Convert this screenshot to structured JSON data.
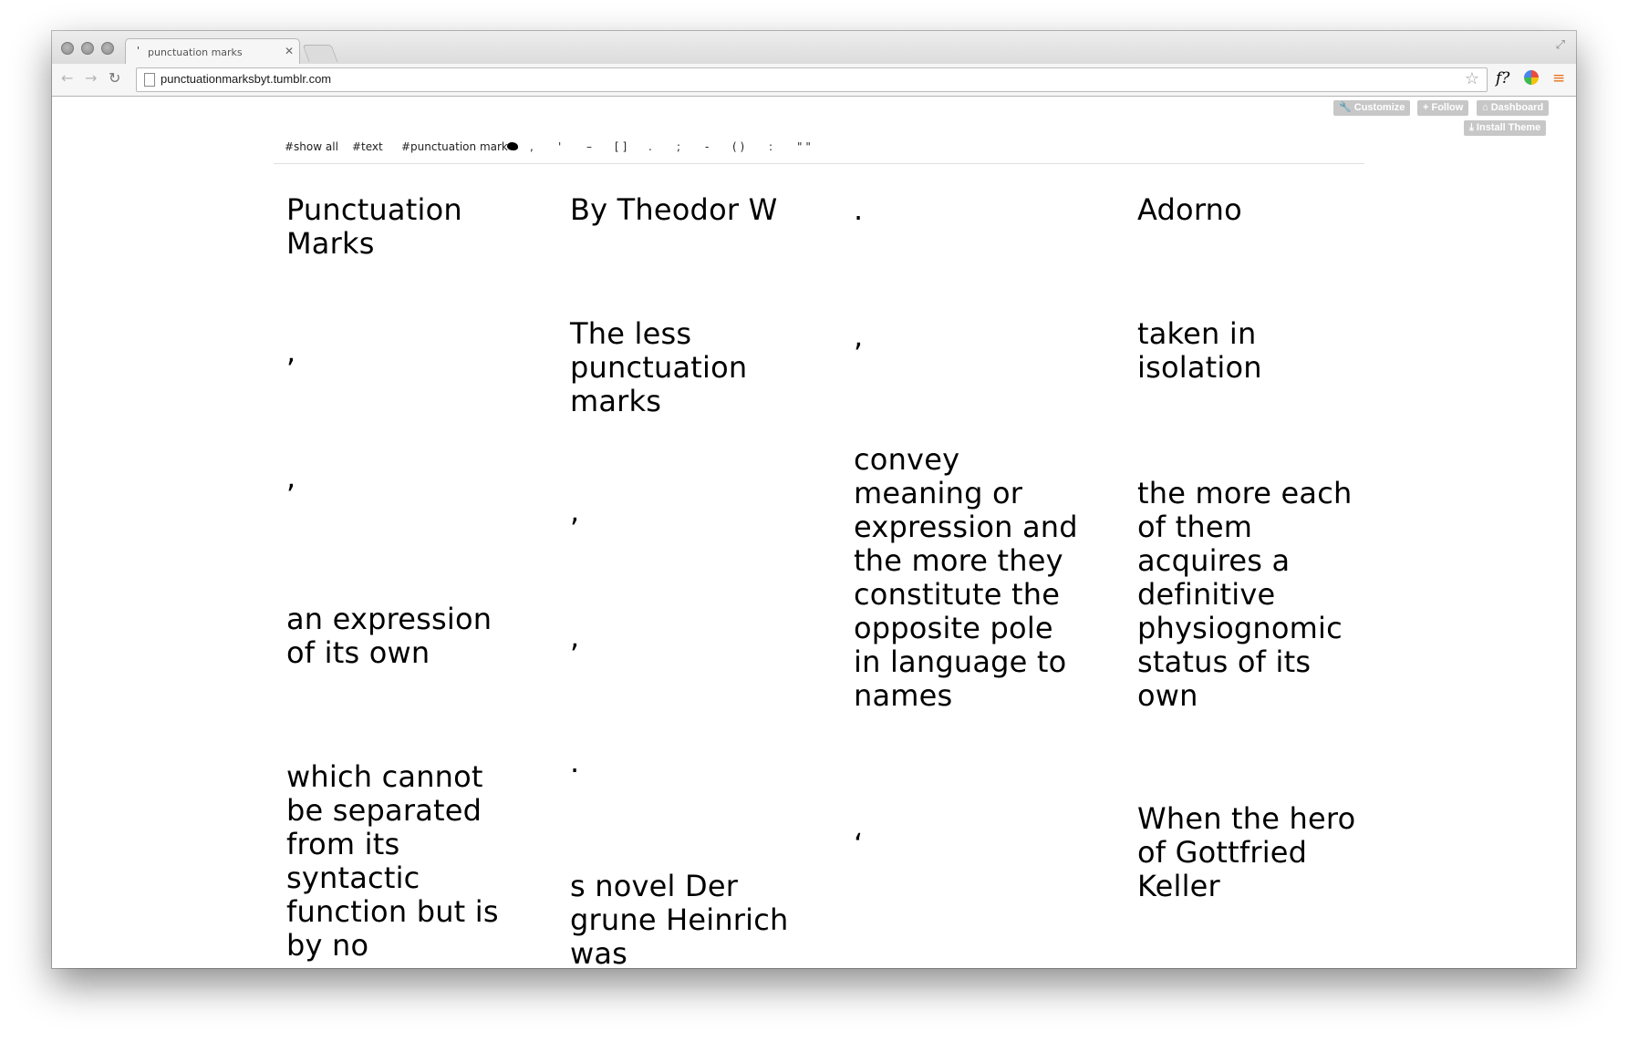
{
  "browser": {
    "tab_title": "punctuation marks",
    "tab_favicon": "'",
    "tab_close": "✕",
    "url": "punctuationmarksbyt.tumblr.com",
    "icons": [
      "back-arrow-icon",
      "forward-arrow-icon",
      "reload-icon",
      "page-icon",
      "star-icon",
      "font-extension-icon",
      "color-extension-icon",
      "menu-icon"
    ],
    "ext_font_label": "f?"
  },
  "tumblr_controls": {
    "customize": "Customize",
    "follow": "Follow",
    "dashboard": "Dashboard",
    "install_theme": "Install Theme"
  },
  "filters": {
    "show_all": "#show all",
    "text": "#text",
    "punctuation_mark": "#punctuation mark",
    "marks": [
      ",",
      "'",
      "–",
      "[ ]",
      ".",
      ";",
      "-",
      "( )",
      ":",
      "\" \""
    ]
  },
  "posts": {
    "c1": [
      "Punctuation Marks",
      ",",
      ",",
      "an expression of its own",
      "which cannot be separated from its syntactic function but is by no"
    ],
    "c2": [
      "By Theodor W",
      "The less punctuation marks",
      ",",
      ",",
      ".",
      "s novel Der grune Heinrich was"
    ],
    "c3": [
      ".",
      ",",
      "convey meaning or expression and the more they constitute the opposite pole in language to names",
      "‘"
    ],
    "c4": [
      "Adorno",
      "taken in isolation",
      "the more each of them acquires a definitive physiognomic status of its own",
      "When the hero of Gottfried Keller"
    ]
  }
}
